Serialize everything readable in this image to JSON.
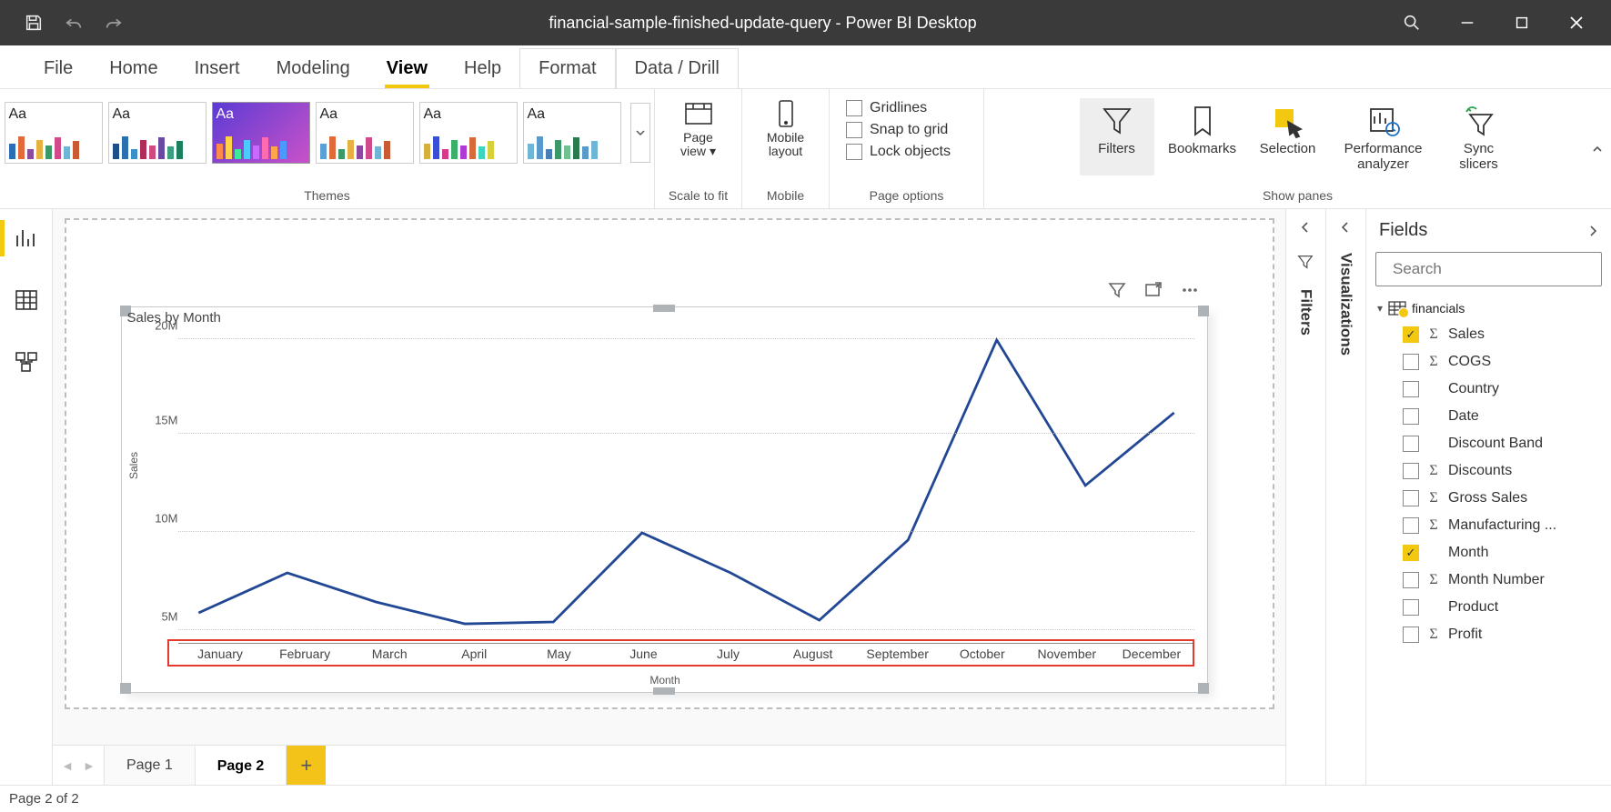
{
  "titlebar": {
    "title": "financial-sample-finished-update-query - Power BI Desktop"
  },
  "menu": {
    "file": "File",
    "home": "Home",
    "insert": "Insert",
    "modeling": "Modeling",
    "view": "View",
    "help": "Help",
    "format": "Format",
    "datadrill": "Data / Drill"
  },
  "ribbon": {
    "themes_label": "Themes",
    "scale_label": "Scale to fit",
    "page_view": "Page\nview",
    "mobile_layout": "Mobile\nlayout",
    "mobile_label": "Mobile",
    "page_options_label": "Page options",
    "gridlines": "Gridlines",
    "snap": "Snap to grid",
    "lock": "Lock objects",
    "show_panes_label": "Show panes",
    "filters": "Filters",
    "bookmarks": "Bookmarks",
    "selection": "Selection",
    "perf": "Performance\nanalyzer",
    "sync": "Sync\nslicers"
  },
  "collapsed": {
    "filters": "Filters",
    "viz": "Visualizations"
  },
  "fields": {
    "header": "Fields",
    "search_placeholder": "Search",
    "table": "financials",
    "items": [
      {
        "label": "Sales",
        "checked": true,
        "sigma": true
      },
      {
        "label": "COGS",
        "checked": false,
        "sigma": true
      },
      {
        "label": "Country",
        "checked": false,
        "sigma": false
      },
      {
        "label": "Date",
        "checked": false,
        "sigma": false
      },
      {
        "label": "Discount Band",
        "checked": false,
        "sigma": false
      },
      {
        "label": "Discounts",
        "checked": false,
        "sigma": true
      },
      {
        "label": "Gross Sales",
        "checked": false,
        "sigma": true
      },
      {
        "label": "Manufacturing ...",
        "checked": false,
        "sigma": true
      },
      {
        "label": "Month",
        "checked": true,
        "sigma": false
      },
      {
        "label": "Month Number",
        "checked": false,
        "sigma": true
      },
      {
        "label": "Product",
        "checked": false,
        "sigma": false
      },
      {
        "label": "Profit",
        "checked": false,
        "sigma": true
      }
    ]
  },
  "tabs": {
    "page1": "Page 1",
    "page2": "Page 2"
  },
  "status": {
    "text": "Page 2 of 2"
  },
  "chart_data": {
    "type": "line",
    "title": "Sales by Month",
    "xlabel": "Month",
    "ylabel": "Sales",
    "categories": [
      "January",
      "February",
      "March",
      "April",
      "May",
      "June",
      "July",
      "August",
      "September",
      "October",
      "November",
      "December"
    ],
    "values": [
      5.0,
      7.2,
      5.6,
      4.4,
      4.5,
      9.4,
      7.2,
      4.6,
      9.0,
      20.0,
      12.0,
      16.0
    ],
    "y_ticks": [
      "5M",
      "10M",
      "15M",
      "20M"
    ],
    "ylim": [
      4,
      20
    ]
  }
}
